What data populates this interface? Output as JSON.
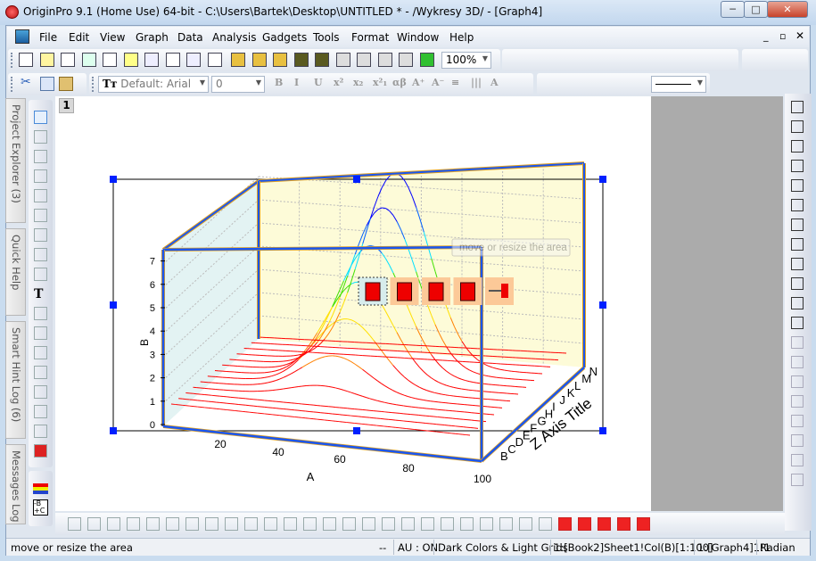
{
  "window": {
    "title": "OriginPro 9.1 (Home Use) 64-bit - C:\\Users\\Bartek\\Desktop\\UNTITLED * - /Wykresy 3D/ - [Graph4]",
    "minimize": "─",
    "maximize": "□",
    "close": "✕"
  },
  "menu": [
    "File",
    "Edit",
    "View",
    "Graph",
    "Data",
    "Analysis",
    "Gadgets",
    "Tools",
    "Format",
    "Window",
    "Help"
  ],
  "toolbar1": {
    "icons": [
      "new-project-icon",
      "new-worksheet-icon",
      "new-matrix-icon",
      "new-excel-icon",
      "new-graph-icon",
      "new-matrix-book-icon",
      "new-function-icon",
      "new-layout-icon",
      "new-notes-icon",
      "new-3d-graph-icon",
      "open-icon",
      "open-template-icon",
      "open-excel-icon",
      "save-project-icon",
      "save-template-icon",
      "import-wizard-icon",
      "import-single-ascii-icon",
      "import-multiple-ascii-icon",
      "duplicate-icon",
      "recalculate-icon"
    ],
    "zoom": "100%"
  },
  "toolbar2": {
    "font": "Default: Arial",
    "size": "0",
    "format_labels": [
      "B",
      "I",
      "U",
      "x²",
      "x₂",
      "x²₁",
      "αβ",
      "A⁺",
      "A⁻",
      "≡",
      "|||",
      "A"
    ]
  },
  "side_tabs": [
    "Project Explorer (3)",
    "Quick Help",
    "Smart Hint Log (6)",
    "Messages Log"
  ],
  "tools": [
    "pointer-icon",
    "zoom-in-icon",
    "zoom-out-icon",
    "screen-reader-icon",
    "data-selector-icon",
    "data-reader-icon",
    "region-mask-icon",
    "draw-data-icon",
    "scale-icon",
    "text-tool-icon",
    "arrow-tool-icon",
    "line-tool-icon",
    "rectangle-tool-icon",
    "hand-icon",
    "insert-equation-icon",
    "insert-graph-icon",
    "move-layer-icon",
    "3d-rotate-icon"
  ],
  "page_tab": "1",
  "graph": {
    "y_axis_title": "B",
    "x_axis_title": "A",
    "z_axis_title": "Z Axis Title",
    "y_ticks": [
      "0",
      "1",
      "2",
      "3",
      "4",
      "5",
      "6",
      "7"
    ],
    "x_ticks": [
      "20",
      "40",
      "60",
      "80",
      "100"
    ],
    "z_ticks": [
      "B",
      "C",
      "D",
      "E",
      "F",
      "G",
      "H",
      "I",
      "J",
      "K",
      "L",
      "M",
      "N"
    ],
    "tooltip": "move or resize the area",
    "mini_toolbar": [
      "move-icon",
      "resize-icon",
      "rotate-icon",
      "stretch-icon",
      "pin-icon"
    ],
    "colors": {
      "back_wall": "#fdfbd8",
      "side_wall": "#e3f3f3",
      "frame": "#1a56f0",
      "frame_edge": "#e0a020",
      "curve_low": "#ff0000",
      "curve_high": "#0000ff"
    }
  },
  "status": {
    "hint": "move or resize the area",
    "dash": "--",
    "au": "AU : ON",
    "theme": "Dark Colors & Light Grids",
    "data": "1:[Book2]Sheet1!Col(B)[1:100]",
    "layer": "1:[Graph4]1!1",
    "angle": "Radian"
  }
}
